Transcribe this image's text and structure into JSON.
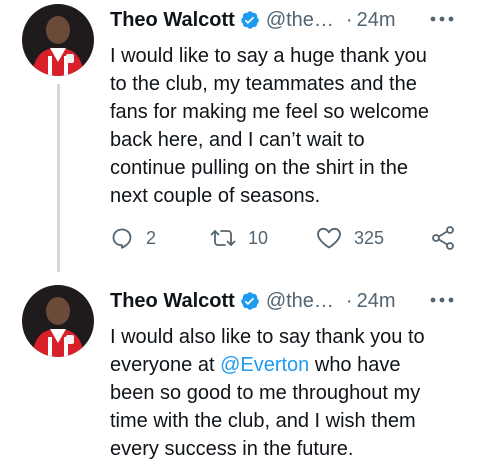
{
  "colors": {
    "accent": "#1d9bf0",
    "secondary_text": "#536471",
    "thread_line": "#cfd9de"
  },
  "tweets": [
    {
      "author": "Theo Walcott",
      "handle": "@the…",
      "separator": "·",
      "time": "24m",
      "lines": [
        "I would like to say a huge thank you",
        "to the club, my teammates and the",
        "fans for making me feel so welcome",
        "back here, and I can’t wait to",
        "continue pulling on the shirt in the",
        "next couple of seasons."
      ],
      "replies": "2",
      "retweets": "10",
      "likes": "325"
    },
    {
      "author": "Theo Walcott",
      "handle": "@the…",
      "separator": "·",
      "time": "24m",
      "line1": "I would also like to say thank you to",
      "line2_prefix": "everyone at ",
      "line2_mention": "@Everton",
      "line2_suffix": " who have",
      "lines_rest": [
        "been so good to me throughout my",
        "time with the club, and I wish them",
        "every success in the future."
      ]
    }
  ]
}
